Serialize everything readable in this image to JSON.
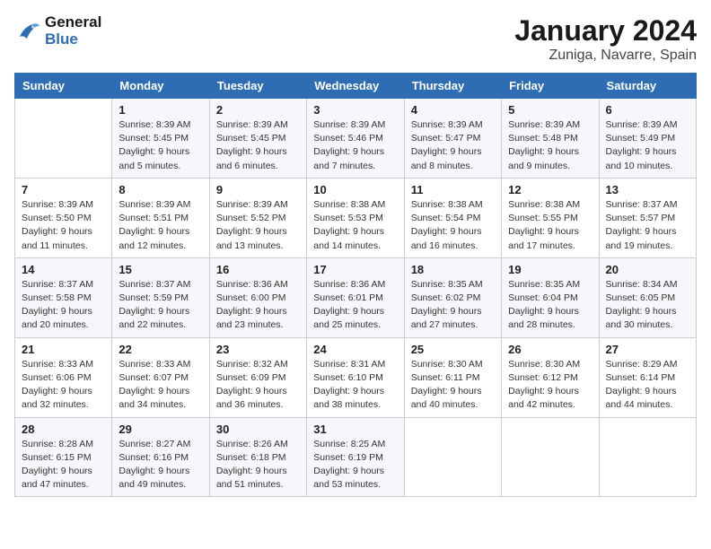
{
  "header": {
    "logo_line1": "General",
    "logo_line2": "Blue",
    "month": "January 2024",
    "location": "Zuniga, Navarre, Spain"
  },
  "weekdays": [
    "Sunday",
    "Monday",
    "Tuesday",
    "Wednesday",
    "Thursday",
    "Friday",
    "Saturday"
  ],
  "weeks": [
    [
      {
        "day": "",
        "info": ""
      },
      {
        "day": "1",
        "info": "Sunrise: 8:39 AM\nSunset: 5:45 PM\nDaylight: 9 hours\nand 5 minutes."
      },
      {
        "day": "2",
        "info": "Sunrise: 8:39 AM\nSunset: 5:45 PM\nDaylight: 9 hours\nand 6 minutes."
      },
      {
        "day": "3",
        "info": "Sunrise: 8:39 AM\nSunset: 5:46 PM\nDaylight: 9 hours\nand 7 minutes."
      },
      {
        "day": "4",
        "info": "Sunrise: 8:39 AM\nSunset: 5:47 PM\nDaylight: 9 hours\nand 8 minutes."
      },
      {
        "day": "5",
        "info": "Sunrise: 8:39 AM\nSunset: 5:48 PM\nDaylight: 9 hours\nand 9 minutes."
      },
      {
        "day": "6",
        "info": "Sunrise: 8:39 AM\nSunset: 5:49 PM\nDaylight: 9 hours\nand 10 minutes."
      }
    ],
    [
      {
        "day": "7",
        "info": "Sunrise: 8:39 AM\nSunset: 5:50 PM\nDaylight: 9 hours\nand 11 minutes."
      },
      {
        "day": "8",
        "info": "Sunrise: 8:39 AM\nSunset: 5:51 PM\nDaylight: 9 hours\nand 12 minutes."
      },
      {
        "day": "9",
        "info": "Sunrise: 8:39 AM\nSunset: 5:52 PM\nDaylight: 9 hours\nand 13 minutes."
      },
      {
        "day": "10",
        "info": "Sunrise: 8:38 AM\nSunset: 5:53 PM\nDaylight: 9 hours\nand 14 minutes."
      },
      {
        "day": "11",
        "info": "Sunrise: 8:38 AM\nSunset: 5:54 PM\nDaylight: 9 hours\nand 16 minutes."
      },
      {
        "day": "12",
        "info": "Sunrise: 8:38 AM\nSunset: 5:55 PM\nDaylight: 9 hours\nand 17 minutes."
      },
      {
        "day": "13",
        "info": "Sunrise: 8:37 AM\nSunset: 5:57 PM\nDaylight: 9 hours\nand 19 minutes."
      }
    ],
    [
      {
        "day": "14",
        "info": "Sunrise: 8:37 AM\nSunset: 5:58 PM\nDaylight: 9 hours\nand 20 minutes."
      },
      {
        "day": "15",
        "info": "Sunrise: 8:37 AM\nSunset: 5:59 PM\nDaylight: 9 hours\nand 22 minutes."
      },
      {
        "day": "16",
        "info": "Sunrise: 8:36 AM\nSunset: 6:00 PM\nDaylight: 9 hours\nand 23 minutes."
      },
      {
        "day": "17",
        "info": "Sunrise: 8:36 AM\nSunset: 6:01 PM\nDaylight: 9 hours\nand 25 minutes."
      },
      {
        "day": "18",
        "info": "Sunrise: 8:35 AM\nSunset: 6:02 PM\nDaylight: 9 hours\nand 27 minutes."
      },
      {
        "day": "19",
        "info": "Sunrise: 8:35 AM\nSunset: 6:04 PM\nDaylight: 9 hours\nand 28 minutes."
      },
      {
        "day": "20",
        "info": "Sunrise: 8:34 AM\nSunset: 6:05 PM\nDaylight: 9 hours\nand 30 minutes."
      }
    ],
    [
      {
        "day": "21",
        "info": "Sunrise: 8:33 AM\nSunset: 6:06 PM\nDaylight: 9 hours\nand 32 minutes."
      },
      {
        "day": "22",
        "info": "Sunrise: 8:33 AM\nSunset: 6:07 PM\nDaylight: 9 hours\nand 34 minutes."
      },
      {
        "day": "23",
        "info": "Sunrise: 8:32 AM\nSunset: 6:09 PM\nDaylight: 9 hours\nand 36 minutes."
      },
      {
        "day": "24",
        "info": "Sunrise: 8:31 AM\nSunset: 6:10 PM\nDaylight: 9 hours\nand 38 minutes."
      },
      {
        "day": "25",
        "info": "Sunrise: 8:30 AM\nSunset: 6:11 PM\nDaylight: 9 hours\nand 40 minutes."
      },
      {
        "day": "26",
        "info": "Sunrise: 8:30 AM\nSunset: 6:12 PM\nDaylight: 9 hours\nand 42 minutes."
      },
      {
        "day": "27",
        "info": "Sunrise: 8:29 AM\nSunset: 6:14 PM\nDaylight: 9 hours\nand 44 minutes."
      }
    ],
    [
      {
        "day": "28",
        "info": "Sunrise: 8:28 AM\nSunset: 6:15 PM\nDaylight: 9 hours\nand 47 minutes."
      },
      {
        "day": "29",
        "info": "Sunrise: 8:27 AM\nSunset: 6:16 PM\nDaylight: 9 hours\nand 49 minutes."
      },
      {
        "day": "30",
        "info": "Sunrise: 8:26 AM\nSunset: 6:18 PM\nDaylight: 9 hours\nand 51 minutes."
      },
      {
        "day": "31",
        "info": "Sunrise: 8:25 AM\nSunset: 6:19 PM\nDaylight: 9 hours\nand 53 minutes."
      },
      {
        "day": "",
        "info": ""
      },
      {
        "day": "",
        "info": ""
      },
      {
        "day": "",
        "info": ""
      }
    ]
  ]
}
